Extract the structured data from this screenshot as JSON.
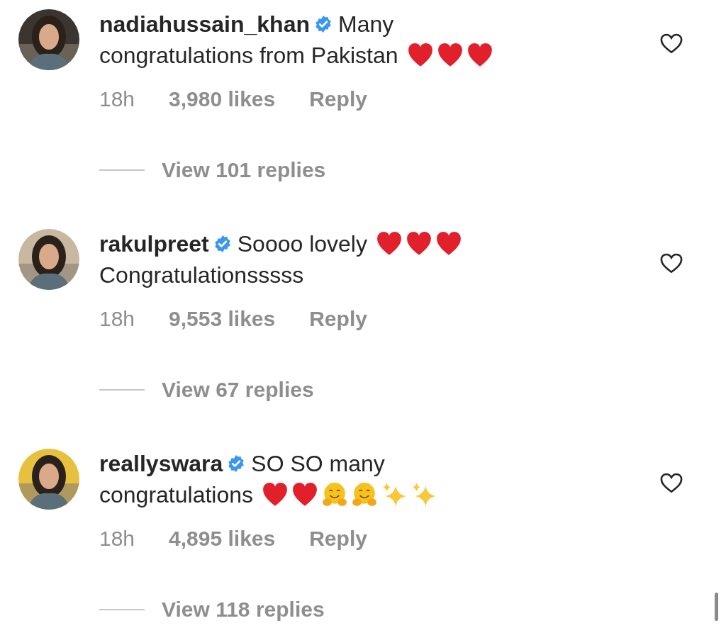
{
  "comments": [
    {
      "username": "nadiahussain_khan",
      "verified": true,
      "lines": [
        {
          "text": "Many"
        },
        {
          "text": "congratulations from Pakistan",
          "emojis": [
            {
              "kind": "heart"
            },
            {
              "kind": "heart"
            },
            {
              "kind": "heart"
            }
          ]
        }
      ],
      "time": "18h",
      "likes": "3,980 likes",
      "reply": "Reply",
      "view_replies": "View 101 replies",
      "liked": false
    },
    {
      "username": "rakulpreet",
      "verified": true,
      "lines": [
        {
          "text": "Soooo lovely",
          "emojis": [
            {
              "kind": "heart"
            },
            {
              "kind": "heart"
            },
            {
              "kind": "heart"
            }
          ]
        },
        {
          "text": "Congratulationsssss"
        }
      ],
      "time": "18h",
      "likes": "9,553 likes",
      "reply": "Reply",
      "view_replies": "View 67 replies",
      "liked": false
    },
    {
      "username": "reallyswara",
      "verified": true,
      "lines": [
        {
          "text": "SO SO many"
        },
        {
          "text": "congratulations",
          "emojis": [
            {
              "kind": "heart"
            },
            {
              "kind": "heart"
            },
            {
              "kind": "hug"
            },
            {
              "kind": "hug"
            },
            {
              "kind": "sparkles"
            },
            {
              "kind": "sparkles"
            }
          ]
        }
      ],
      "time": "18h",
      "likes": "4,895 likes",
      "reply": "Reply",
      "view_replies": "View 118 replies",
      "liked": false
    }
  ]
}
